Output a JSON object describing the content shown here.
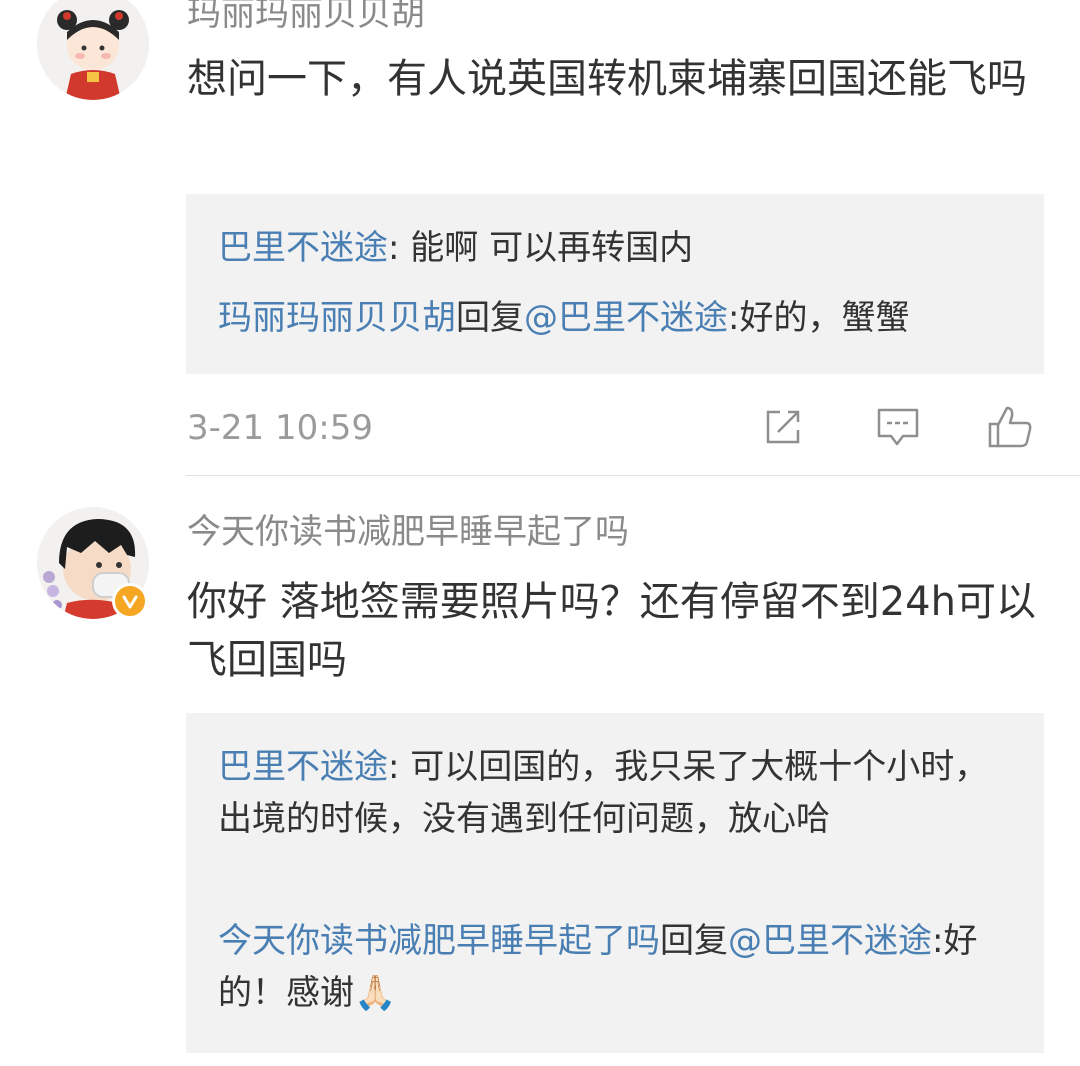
{
  "comments": [
    {
      "username": "玛丽玛丽贝贝胡",
      "text": "想问一下，有人说英国转机柬埔寨回国还能飞吗",
      "replies": [
        {
          "author": "巴里不迷途",
          "sep": ": ",
          "text": "能啊 可以再转国内"
        },
        {
          "author": "玛丽玛丽贝贝胡",
          "reply_word": "回复",
          "mention": "@巴里不迷途",
          "sep": ":",
          "text": "好的，蟹蟹"
        }
      ],
      "timestamp": "3-21 10:59"
    },
    {
      "username": "今天你读书减肥早睡早起了吗",
      "text": "你好 落地签需要照片吗？还有停留不到24h可以飞回国吗",
      "replies": [
        {
          "author": "巴里不迷途",
          "sep": ": ",
          "text": "可以回国的，我只呆了大概十个小时，出境的时候，没有遇到任何问题，放心哈"
        },
        {
          "author": "今天你读书减肥早睡早起了吗",
          "reply_word": "回复",
          "mention": "@巴里不迷途",
          "sep": ":",
          "text": "好的！感谢🙏🏻"
        }
      ]
    }
  ],
  "icons": {
    "share": "share-icon",
    "comment": "comment-icon",
    "like": "thumbs-up-icon",
    "verified": "verified-badge-icon"
  },
  "colors": {
    "link": "#4a7fb3",
    "reply_box": "#f2f2f2",
    "text": "#333333",
    "muted": "#8a8a8a",
    "badge": "#f5a623"
  }
}
